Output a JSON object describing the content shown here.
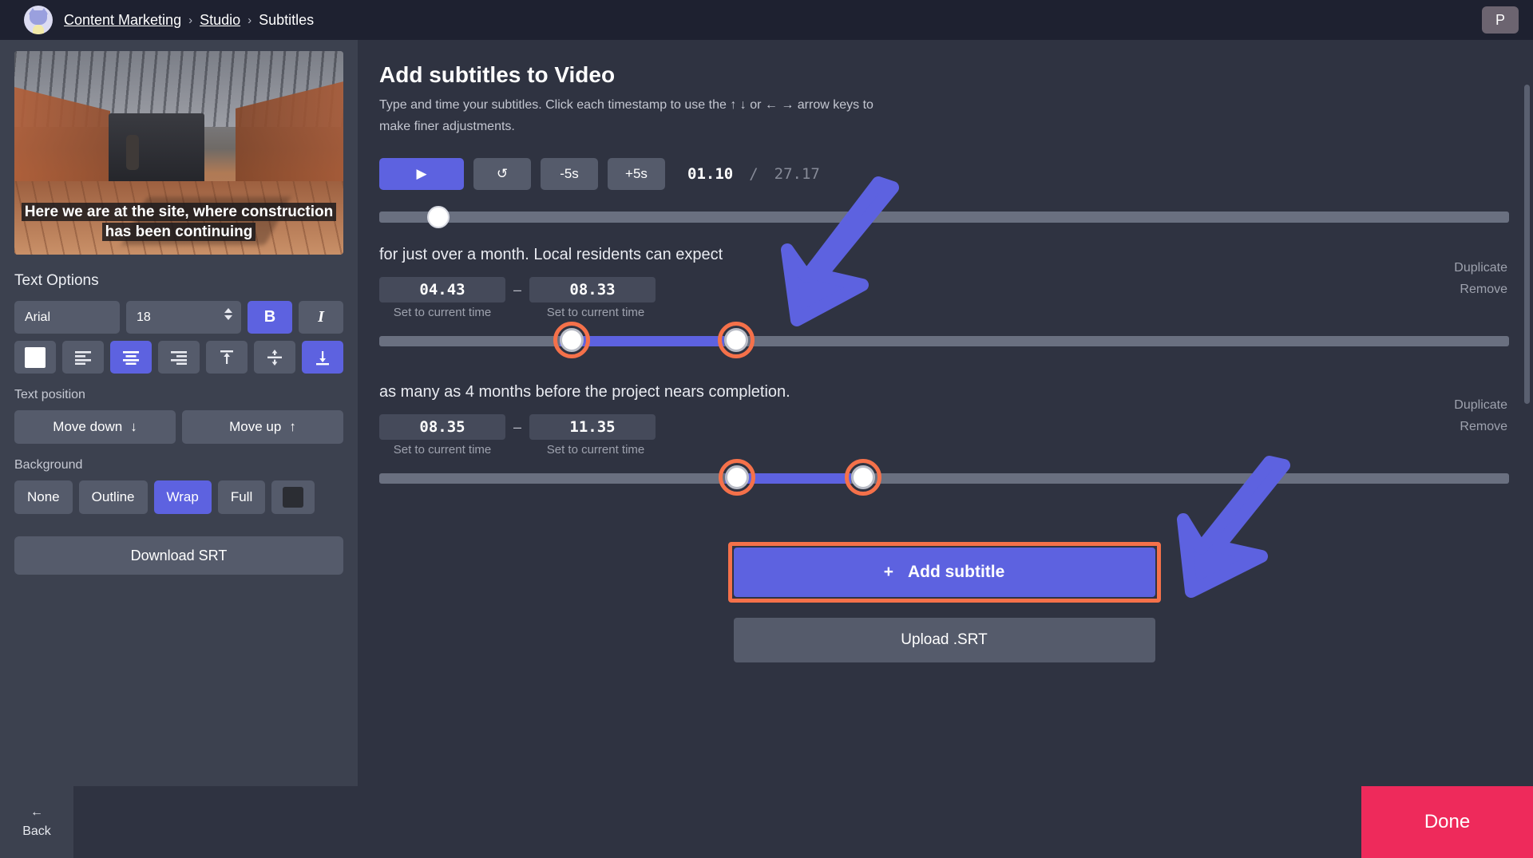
{
  "topbar": {
    "avatar_name": "cat-avatar",
    "breadcrumb": {
      "workspace": "Content Marketing",
      "section": "Studio",
      "current": "Subtitles",
      "separator": "›"
    },
    "profile_initial": "P"
  },
  "sidebar": {
    "video_caption": "Here we are at the site, where construction has been continuing",
    "text_options_title": "Text Options",
    "font_family": "Arial",
    "font_size": "18",
    "bold_label": "B",
    "italic_label": "I",
    "text_color": "#ffffff",
    "align_icons": [
      "align-left-icon",
      "align-center-icon",
      "align-right-icon",
      "align-top-icon",
      "align-middle-icon",
      "align-bottom-icon"
    ],
    "text_position_label": "Text position",
    "move_down_label": "Move down",
    "move_down_arrow": "↓",
    "move_up_label": "Move up",
    "move_up_arrow": "↑",
    "background_label": "Background",
    "background_options": [
      "None",
      "Outline",
      "Wrap",
      "Full"
    ],
    "background_selected": "Wrap",
    "background_color": "#2b2d33",
    "download_srt_label": "Download SRT"
  },
  "main": {
    "title": "Add subtitles to Video",
    "description": "Type and time your subtitles. Click each timestamp to use the ↑ ↓ or ← → arrow keys to make finer adjustments.",
    "playback": {
      "play_icon": "▶",
      "restart_icon": "↺",
      "back5_label": "-5s",
      "forward5_label": "+5s",
      "current_time": "01.10",
      "time_separator": "/",
      "total_time": "27.17"
    },
    "subtitles": [
      {
        "text": "for just over a month. Local residents can expect",
        "start": "04.43",
        "end": "08.33",
        "dash": "–",
        "set_start_label": "Set to current time",
        "set_end_label": "Set to current time",
        "duplicate_label": "Duplicate",
        "remove_label": "Remove",
        "range_start_pct": 16,
        "range_end_pct": 30.5
      },
      {
        "text": "as many as 4 months before the project nears completion.",
        "start": "08.35",
        "end": "11.35",
        "dash": "–",
        "set_start_label": "Set to current time",
        "set_end_label": "Set to current time",
        "duplicate_label": "Duplicate",
        "remove_label": "Remove",
        "range_start_pct": 30.6,
        "range_end_pct": 41.8
      }
    ],
    "add_subtitle_label": "Add subtitle",
    "add_subtitle_icon": "+",
    "upload_srt_label": "Upload .SRT"
  },
  "bottombar": {
    "back_label": "Back",
    "back_arrow": "←",
    "done_label": "Done"
  },
  "colors": {
    "accent_blue": "#5d62e0",
    "highlight_orange": "#f5714a",
    "done_red": "#ee2a5b",
    "panel_dark": "#2f3341",
    "sidebar": "#3c414f",
    "topbar": "#1e2130"
  }
}
